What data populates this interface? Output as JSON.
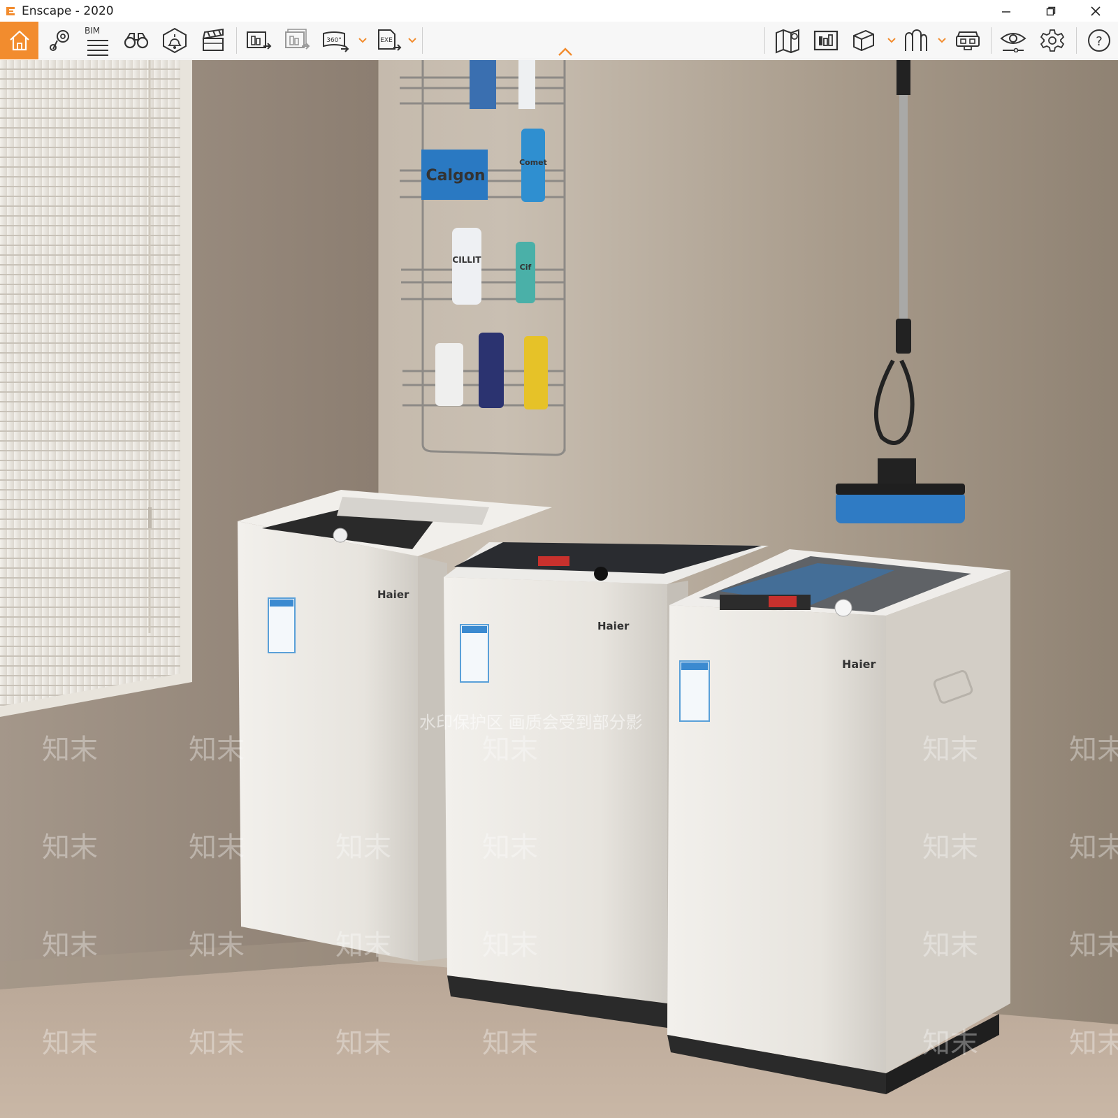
{
  "window": {
    "title": "Enscape - 2020",
    "controls": {
      "minimize": "minimize-icon",
      "restore": "restore-icon",
      "close": "close-icon"
    }
  },
  "toolbar": {
    "accent_color": "#f28c2e",
    "left_tools": [
      {
        "name": "home",
        "icon": "home-icon"
      },
      {
        "name": "view-management",
        "icon": "location-pin-icon"
      },
      {
        "name": "bim",
        "icon": "bim-list-icon",
        "label": "BIM"
      },
      {
        "name": "binoculars",
        "icon": "binoculars-icon"
      },
      {
        "name": "atmosphere",
        "icon": "atmosphere-icon"
      },
      {
        "name": "video-editor",
        "icon": "clapperboard-icon"
      }
    ],
    "export_tools": [
      {
        "name": "batch-render",
        "icon": "batch-render-icon"
      },
      {
        "name": "batch-render-all",
        "icon": "batch-render-all-icon"
      },
      {
        "name": "panorama",
        "icon": "panorama-icon",
        "label": "360°",
        "has_dropdown": true
      },
      {
        "name": "exe-export",
        "icon": "exe-export-icon",
        "label": "EXE",
        "has_dropdown": true
      }
    ],
    "right_tools": [
      {
        "name": "map",
        "icon": "map-icon"
      },
      {
        "name": "capture",
        "icon": "capture-icon"
      },
      {
        "name": "view-cube",
        "icon": "cube-icon",
        "has_dropdown": true
      },
      {
        "name": "asset-library",
        "icon": "asset-library-icon",
        "has_dropdown": true
      },
      {
        "name": "vr-headset",
        "icon": "vr-headset-icon"
      },
      {
        "name": "visual-settings",
        "icon": "eye-settings-icon"
      },
      {
        "name": "general-settings",
        "icon": "gear-icon"
      },
      {
        "name": "help",
        "icon": "help-icon",
        "label": "?"
      }
    ]
  },
  "scene": {
    "description_visible_text": {
      "brand_1": "Haier",
      "brand_2": "Haier",
      "brand_3": "Haier",
      "product_box": "Calgon",
      "bottle_1": "CILLIT",
      "bottle_2": "Comet",
      "bottle_3": "Cif"
    },
    "watermark": {
      "banner": "水印保护区  画质会受到部分影",
      "tile": "知末"
    }
  }
}
